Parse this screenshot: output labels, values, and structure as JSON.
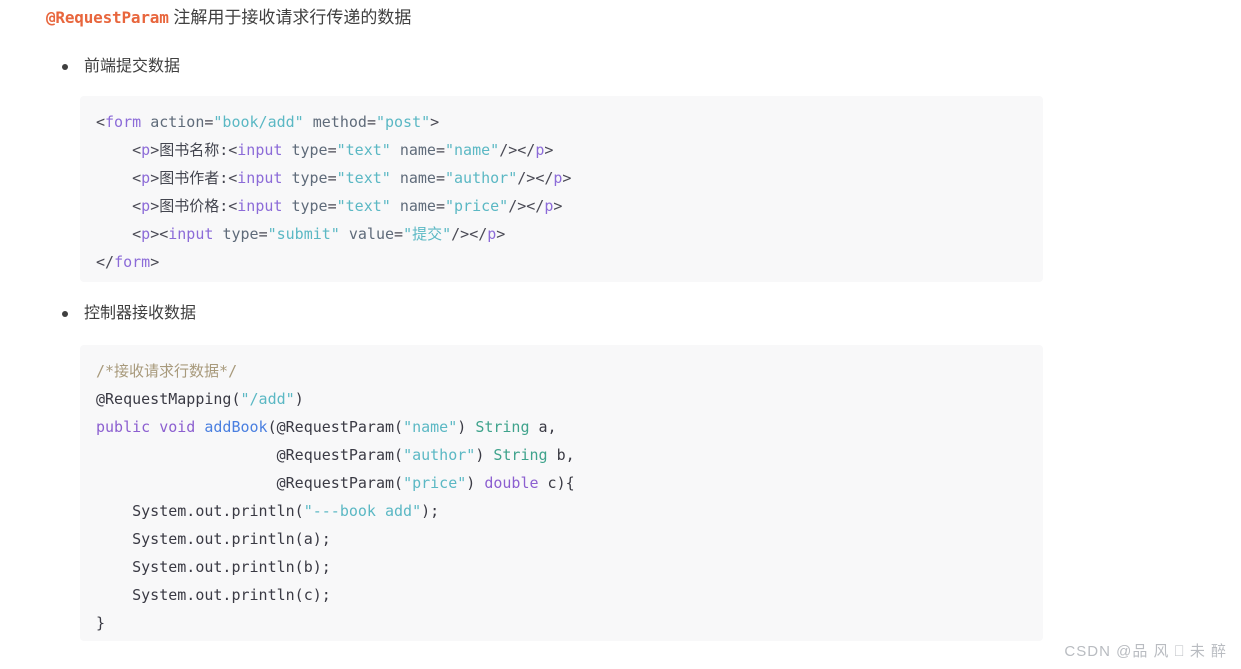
{
  "heading": {
    "code": "@RequestParam",
    "text": " 注解用于接收请求行传递的数据"
  },
  "bullets": [
    {
      "label": "前端提交数据"
    },
    {
      "label": "控制器接收数据"
    }
  ],
  "code_blocks": [
    {
      "language": "html",
      "lines": [
        "<form action=\"book/add\" method=\"post\">",
        "    <p>图书名称:<input type=\"text\" name=\"name\"/></p>",
        "    <p>图书作者:<input type=\"text\" name=\"author\"/></p>",
        "    <p>图书价格:<input type=\"text\" name=\"price\"/></p>",
        "    <p><input type=\"submit\" value=\"提交\"/></p>",
        "</form>"
      ]
    },
    {
      "language": "java",
      "lines": [
        "/*接收请求行数据*/",
        "@RequestMapping(\"/add\")",
        "public void addBook(@RequestParam(\"name\") String a,",
        "                    @RequestParam(\"author\") String b,",
        "                    @RequestParam(\"price\") double c){",
        "    System.out.println(\"---book add\");",
        "    System.out.println(a);",
        "    System.out.println(b);",
        "    System.out.println(c);",
        "}"
      ]
    }
  ],
  "code_html_tokens": [
    [
      [
        "<",
        "punc"
      ],
      [
        "form",
        "tag"
      ],
      [
        " ",
        "plain"
      ],
      [
        "action",
        "attr"
      ],
      [
        "=",
        "punc"
      ],
      [
        "\"book/add\"",
        "str"
      ],
      [
        " ",
        "plain"
      ],
      [
        "method",
        "attr"
      ],
      [
        "=",
        "punc"
      ],
      [
        "\"post\"",
        "str"
      ],
      [
        ">",
        "punc"
      ]
    ],
    [
      [
        "    ",
        "plain"
      ],
      [
        "<",
        "punc"
      ],
      [
        "p",
        "tag"
      ],
      [
        ">",
        "punc"
      ],
      [
        "图书名称:",
        "cjk"
      ],
      [
        "<",
        "punc"
      ],
      [
        "input",
        "tag"
      ],
      [
        " ",
        "plain"
      ],
      [
        "type",
        "attr"
      ],
      [
        "=",
        "punc"
      ],
      [
        "\"text\"",
        "str"
      ],
      [
        " ",
        "plain"
      ],
      [
        "name",
        "attr"
      ],
      [
        "=",
        "punc"
      ],
      [
        "\"name\"",
        "str"
      ],
      [
        "/>",
        "punc"
      ],
      [
        "</",
        "punc"
      ],
      [
        "p",
        "tag"
      ],
      [
        ">",
        "punc"
      ]
    ],
    [
      [
        "    ",
        "plain"
      ],
      [
        "<",
        "punc"
      ],
      [
        "p",
        "tag"
      ],
      [
        ">",
        "punc"
      ],
      [
        "图书作者:",
        "cjk"
      ],
      [
        "<",
        "punc"
      ],
      [
        "input",
        "tag"
      ],
      [
        " ",
        "plain"
      ],
      [
        "type",
        "attr"
      ],
      [
        "=",
        "punc"
      ],
      [
        "\"text\"",
        "str"
      ],
      [
        " ",
        "plain"
      ],
      [
        "name",
        "attr"
      ],
      [
        "=",
        "punc"
      ],
      [
        "\"author\"",
        "str"
      ],
      [
        "/>",
        "punc"
      ],
      [
        "</",
        "punc"
      ],
      [
        "p",
        "tag"
      ],
      [
        ">",
        "punc"
      ]
    ],
    [
      [
        "    ",
        "plain"
      ],
      [
        "<",
        "punc"
      ],
      [
        "p",
        "tag"
      ],
      [
        ">",
        "punc"
      ],
      [
        "图书价格:",
        "cjk"
      ],
      [
        "<",
        "punc"
      ],
      [
        "input",
        "tag"
      ],
      [
        " ",
        "plain"
      ],
      [
        "type",
        "attr"
      ],
      [
        "=",
        "punc"
      ],
      [
        "\"text\"",
        "str"
      ],
      [
        " ",
        "plain"
      ],
      [
        "name",
        "attr"
      ],
      [
        "=",
        "punc"
      ],
      [
        "\"price\"",
        "str"
      ],
      [
        "/>",
        "punc"
      ],
      [
        "</",
        "punc"
      ],
      [
        "p",
        "tag"
      ],
      [
        ">",
        "punc"
      ]
    ],
    [
      [
        "    ",
        "plain"
      ],
      [
        "<",
        "punc"
      ],
      [
        "p",
        "tag"
      ],
      [
        ">",
        "punc"
      ],
      [
        "<",
        "punc"
      ],
      [
        "input",
        "tag"
      ],
      [
        " ",
        "plain"
      ],
      [
        "type",
        "attr"
      ],
      [
        "=",
        "punc"
      ],
      [
        "\"submit\"",
        "str"
      ],
      [
        " ",
        "plain"
      ],
      [
        "value",
        "attr"
      ],
      [
        "=",
        "punc"
      ],
      [
        "\"提交\"",
        "str"
      ],
      [
        "/>",
        "punc"
      ],
      [
        "</",
        "punc"
      ],
      [
        "p",
        "tag"
      ],
      [
        ">",
        "punc"
      ]
    ],
    [
      [
        "</",
        "punc"
      ],
      [
        "form",
        "tag"
      ],
      [
        ">",
        "punc"
      ]
    ]
  ],
  "code_java_tokens": [
    [
      [
        "/*接收请求行数据*/",
        "comment"
      ]
    ],
    [
      [
        "@RequestMapping",
        "anno"
      ],
      [
        "(",
        "plain"
      ],
      [
        "\"/add\"",
        "str"
      ],
      [
        ")",
        "plain"
      ]
    ],
    [
      [
        "public",
        "kw"
      ],
      [
        " ",
        "plain"
      ],
      [
        "void",
        "kw"
      ],
      [
        " ",
        "plain"
      ],
      [
        "addBook",
        "fn"
      ],
      [
        "(",
        "plain"
      ],
      [
        "@RequestParam",
        "anno"
      ],
      [
        "(",
        "plain"
      ],
      [
        "\"name\"",
        "str"
      ],
      [
        ")",
        "plain"
      ],
      [
        " ",
        "plain"
      ],
      [
        "String",
        "type"
      ],
      [
        " a,",
        "plain"
      ]
    ],
    [
      [
        "                    ",
        "plain"
      ],
      [
        "@RequestParam",
        "anno"
      ],
      [
        "(",
        "plain"
      ],
      [
        "\"author\"",
        "str"
      ],
      [
        ")",
        "plain"
      ],
      [
        " ",
        "plain"
      ],
      [
        "String",
        "type"
      ],
      [
        " b,",
        "plain"
      ]
    ],
    [
      [
        "                    ",
        "plain"
      ],
      [
        "@RequestParam",
        "anno"
      ],
      [
        "(",
        "plain"
      ],
      [
        "\"price\"",
        "str"
      ],
      [
        ")",
        "plain"
      ],
      [
        " ",
        "plain"
      ],
      [
        "double",
        "kw"
      ],
      [
        " c){",
        "plain"
      ]
    ],
    [
      [
        "    System.out.println(",
        "plain"
      ],
      [
        "\"---book add\"",
        "str"
      ],
      [
        ");",
        "plain"
      ]
    ],
    [
      [
        "    System.out.println(a);",
        "plain"
      ]
    ],
    [
      [
        "    System.out.println(b);",
        "plain"
      ]
    ],
    [
      [
        "    System.out.println(c);",
        "plain"
      ]
    ],
    [
      [
        "}",
        "plain"
      ]
    ]
  ],
  "watermark": {
    "text": "CSDN @品 风 ⎕ 未 醉"
  }
}
